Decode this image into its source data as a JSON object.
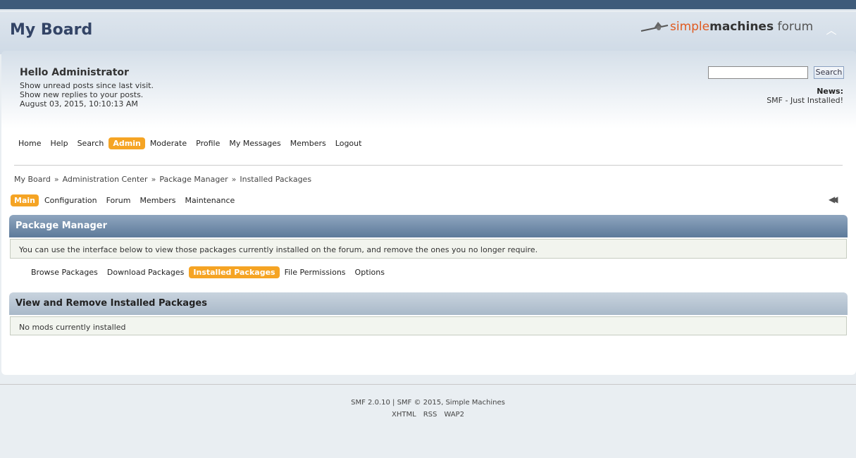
{
  "header": {
    "forum_title": "My Board",
    "logo": {
      "simple": "simple",
      "machines": "machines",
      "forum": " forum"
    },
    "collapse_icon": "chevron-up-icon"
  },
  "user": {
    "greeting": "Hello Administrator",
    "lines": [
      "Show unread posts since last visit.",
      "Show new replies to your posts.",
      "August 03, 2015, 10:10:13 AM"
    ]
  },
  "search": {
    "value": "",
    "button_label": "Search"
  },
  "news": {
    "label": "News:",
    "text": "SMF - Just Installed!"
  },
  "main_menu": {
    "items": [
      "Home",
      "Help",
      "Search",
      "Admin",
      "Moderate",
      "Profile",
      "My Messages",
      "Members",
      "Logout"
    ],
    "active": "Admin"
  },
  "breadcrumb": {
    "items": [
      "My Board",
      "Administration Center",
      "Package Manager",
      "Installed Packages"
    ],
    "separator": "»"
  },
  "admin_tabs": {
    "items": [
      "Main",
      "Configuration",
      "Forum",
      "Members",
      "Maintenance"
    ],
    "active": "Main"
  },
  "package_manager": {
    "title": "Package Manager",
    "description": "You can use the interface below to view those packages currently installed on the forum, and remove the ones you no longer require."
  },
  "sub_tabs": {
    "items": [
      "Browse Packages",
      "Download Packages",
      "Installed Packages",
      "File Permissions",
      "Options"
    ],
    "active": "Installed Packages"
  },
  "installed": {
    "title": "View and Remove Installed Packages",
    "empty_text": "No mods currently installed"
  },
  "footer": {
    "copyright": "SMF 2.0.10 | SMF © 2015, Simple Machines",
    "links": [
      "XHTML",
      "RSS",
      "WAP2"
    ]
  },
  "colors": {
    "topbar": "#3e5b7a",
    "accent_active": "#f5a424",
    "catbar": "#6f88a6",
    "title": "#334466"
  }
}
